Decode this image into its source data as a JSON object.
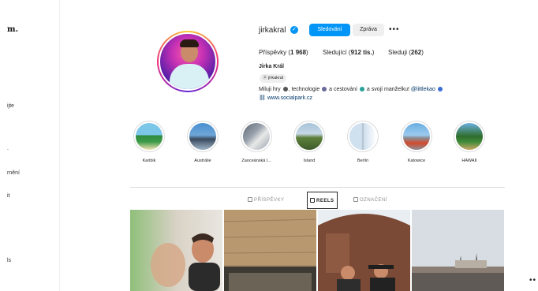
{
  "sidebar": {
    "logo": "m.",
    "fragments": [
      "ijte",
      ".",
      "rnění",
      "it",
      "ls"
    ]
  },
  "profile": {
    "username": "jirkakral",
    "follow_label": "Sledování",
    "message_label": "Zpráva",
    "more_label": "•••",
    "stats": {
      "posts_label": "Příspěvky",
      "posts_value": "1 968",
      "followers_label": "Sledující",
      "followers_value": "912 tis.",
      "following_label": "Sleduji",
      "following_value": "262"
    },
    "full_name": "Jirka Král",
    "threads_handle": "jirkakral",
    "bio_parts": [
      "Miluji hry",
      ", technologie",
      " a cestování",
      " a svojí manželku!",
      "@littlekao"
    ],
    "link": "www.socialpark.cz"
  },
  "highlights": [
    {
      "label": "Karibik",
      "colors": [
        "#7cc6e8",
        "#2d8a3e",
        "#f2e3b3"
      ]
    },
    {
      "label": "Austrálie",
      "colors": [
        "#4a8fd0",
        "#3a4a5e",
        "#9fb4c8"
      ]
    },
    {
      "label": "Zaoceánská l...",
      "colors": [
        "#9aa3ad",
        "#e8e8e8",
        "#5b6570"
      ]
    },
    {
      "label": "Island",
      "colors": [
        "#a7c3d9",
        "#5c7f3a",
        "#3d5a2a"
      ]
    },
    {
      "label": "Berlín",
      "colors": [
        "#cfe0ee",
        "#b8c6d2",
        "#ffffff"
      ]
    },
    {
      "label": "Katowice",
      "colors": [
        "#6aaee0",
        "#8a8f98",
        "#d24a2c"
      ]
    },
    {
      "label": "HAWAII",
      "colors": [
        "#6bb0e0",
        "#2f6d2c",
        "#c9a765"
      ]
    }
  ],
  "tabs": [
    {
      "label": "PŘÍSPĚVKY",
      "active": false
    },
    {
      "label": "REELS",
      "active": true
    },
    {
      "label": "OZNAČENÍ",
      "active": false
    }
  ],
  "colors": {
    "accent": "#0095f6",
    "text": "#262626",
    "muted": "#8e8e8e",
    "link": "#00376b"
  },
  "page_dots": "••"
}
